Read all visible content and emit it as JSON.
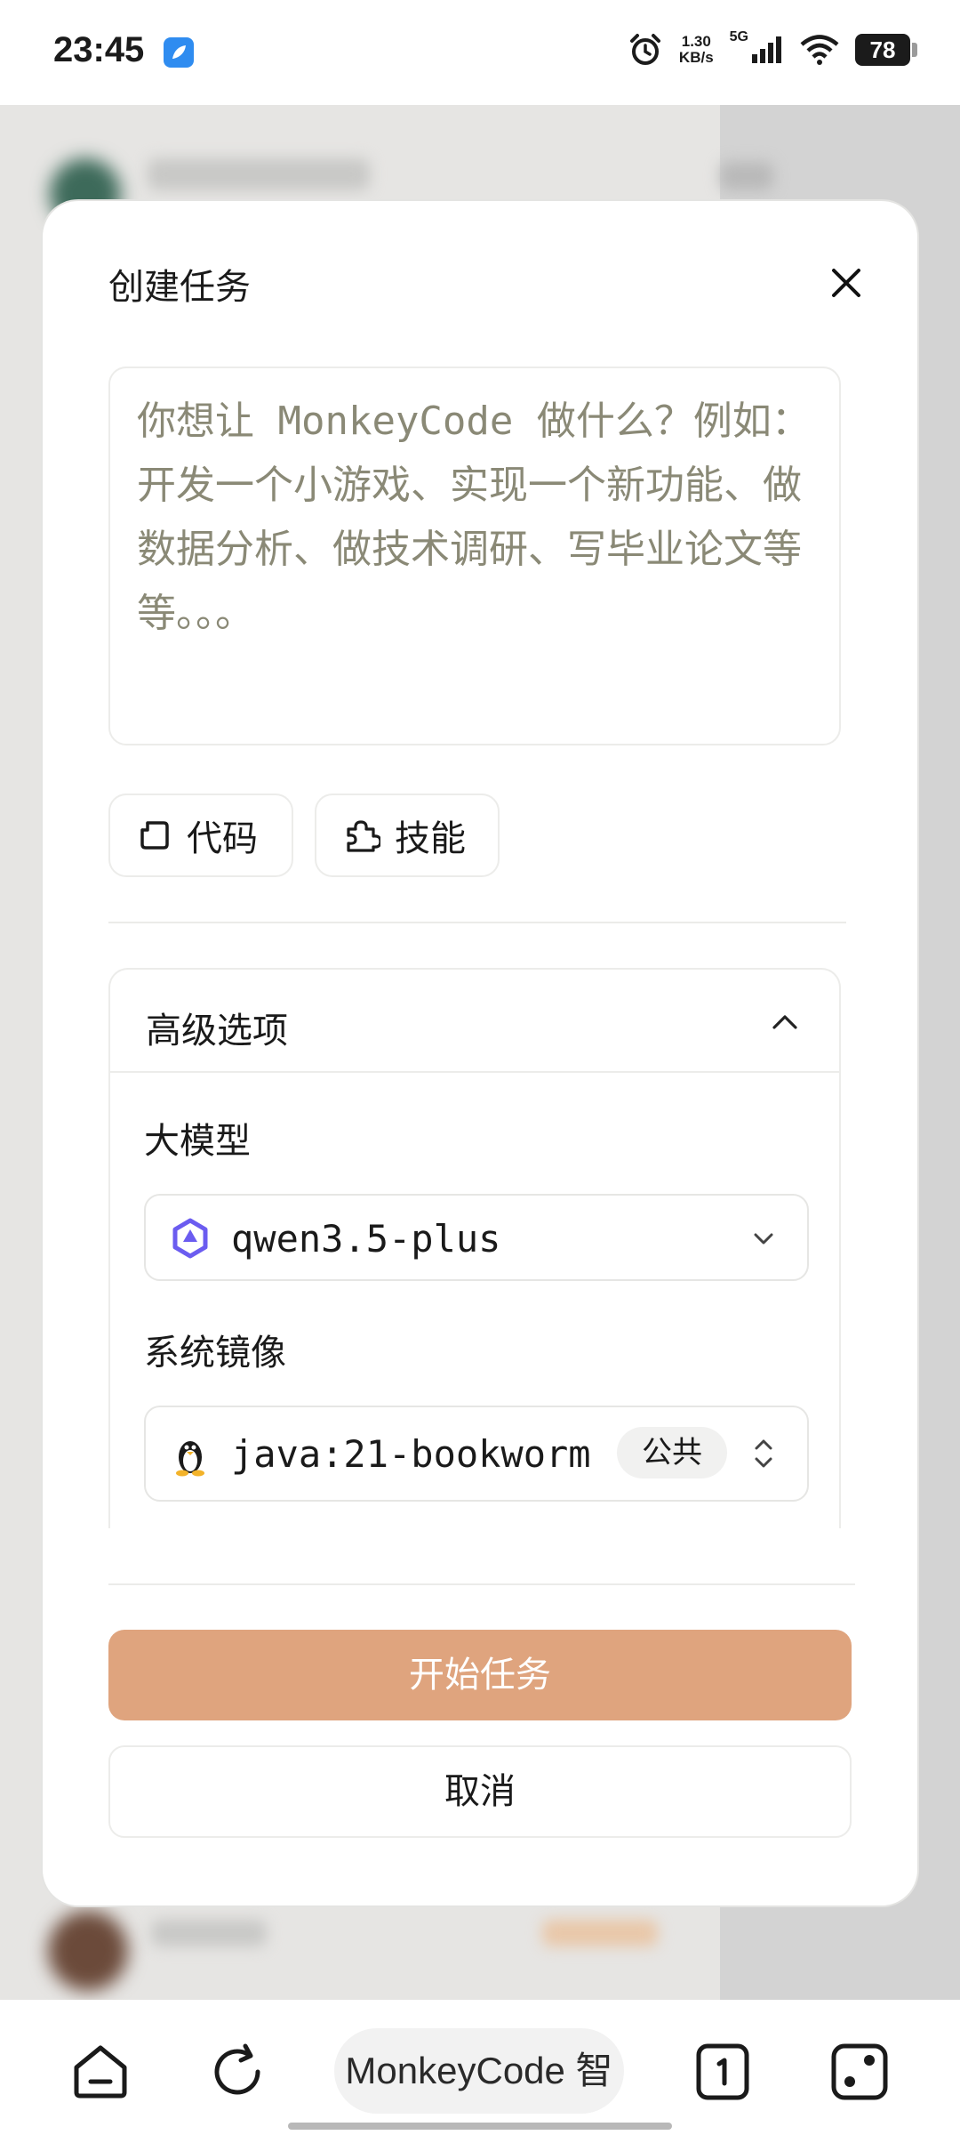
{
  "status_bar": {
    "time": "23:45",
    "net_speed_value": "1.30",
    "net_speed_unit": "KB/s",
    "network": "5G",
    "battery": "78",
    "icons": [
      "app-notification-icon",
      "alarm-icon",
      "signal-icon",
      "wifi-icon",
      "battery-icon"
    ]
  },
  "modal": {
    "title": "创建任务",
    "prompt_placeholder": "你想让 MonkeyCode 做什么？例如：开发一个小游戏、实现一个新功能、做数据分析、做技术调研、写毕业论文等等。。。",
    "chips": {
      "code_label": "代码",
      "skill_label": "技能"
    },
    "advanced": {
      "title": "高级选项",
      "model_label": "大模型",
      "model_value": "qwen3.5-plus",
      "image_label": "系统镜像",
      "image_value": "java:21-bookworm",
      "image_badge": "公共"
    },
    "start_button": "开始任务",
    "cancel_button": "取消"
  },
  "browser_bar": {
    "url_text": "MonkeyCode 智"
  },
  "colors": {
    "accent": "#dfa47e",
    "placeholder": "#8a8976"
  }
}
